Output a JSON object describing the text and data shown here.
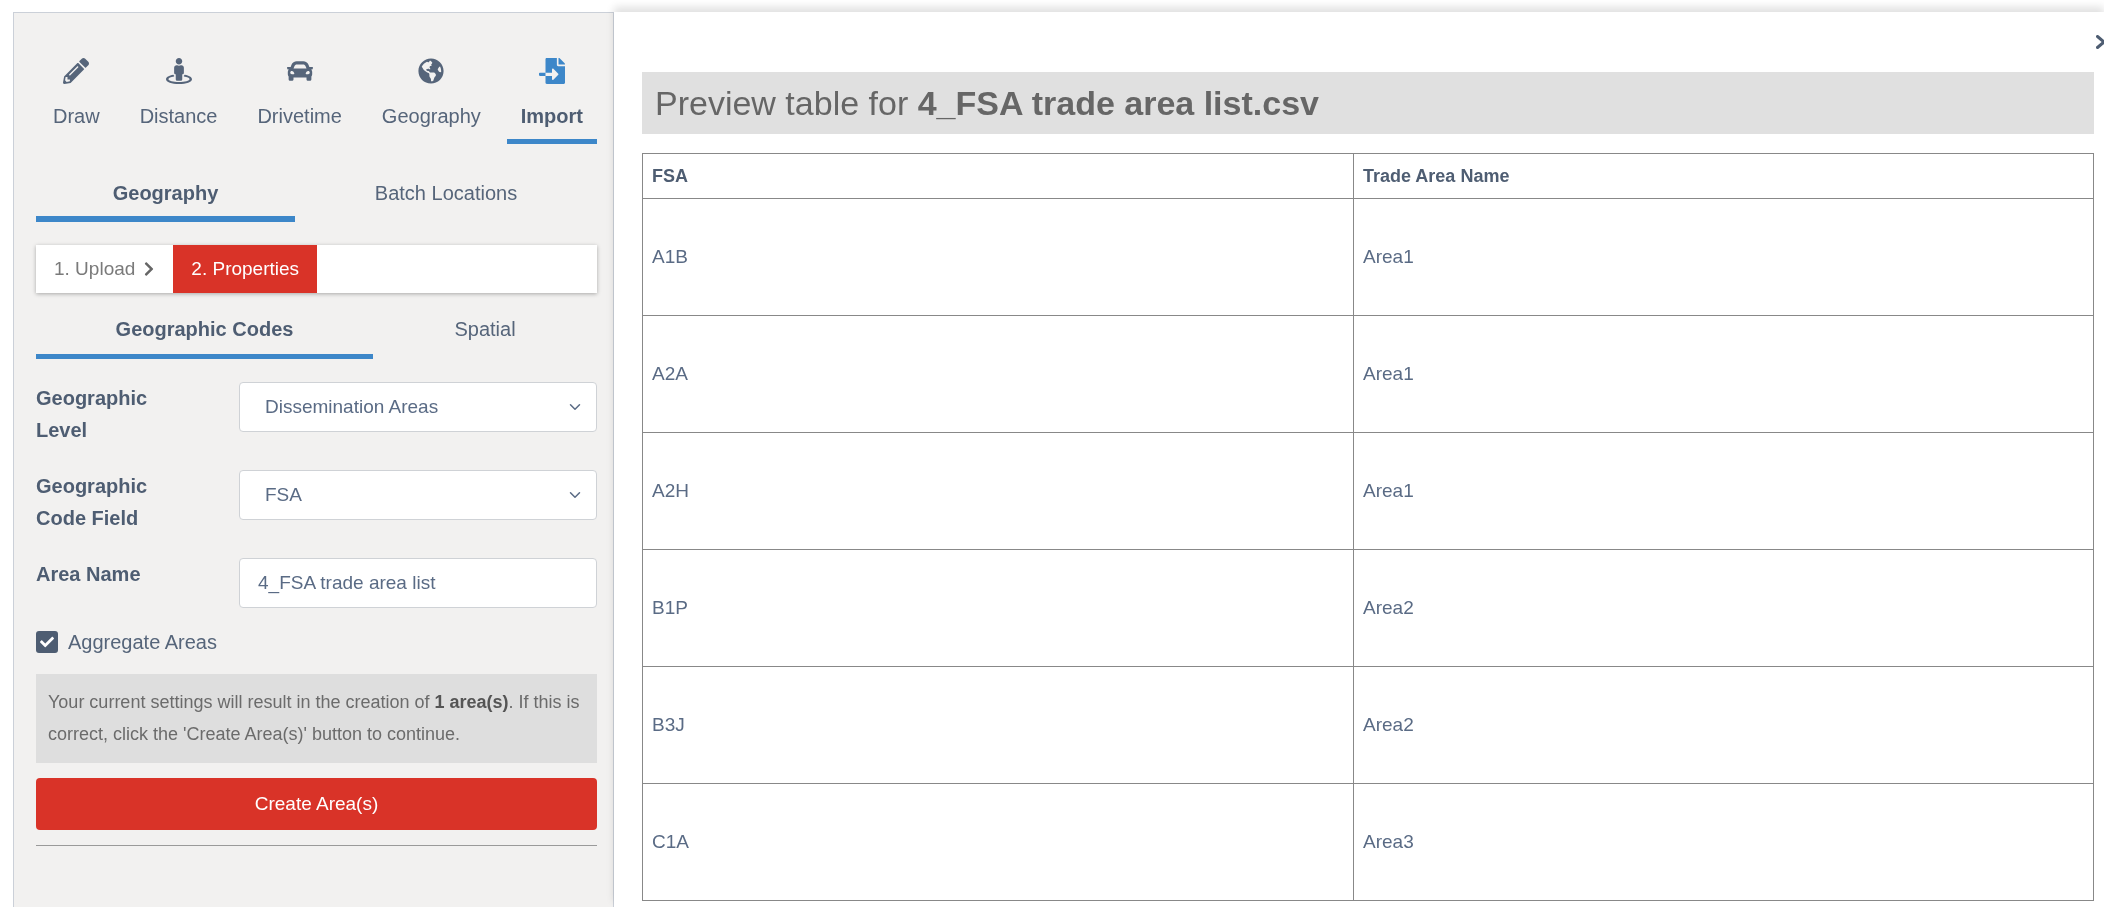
{
  "mode_tabs": [
    {
      "label": "Draw",
      "selected": false
    },
    {
      "label": "Distance",
      "selected": false
    },
    {
      "label": "Drivetime",
      "selected": false
    },
    {
      "label": "Geography",
      "selected": false
    },
    {
      "label": "Import",
      "selected": true
    }
  ],
  "sub_tabs": [
    {
      "label": "Geography",
      "selected": true
    },
    {
      "label": "Batch Locations",
      "selected": false
    }
  ],
  "steps": [
    {
      "label": "1. Upload",
      "selected": false
    },
    {
      "label": "2. Properties",
      "selected": true
    }
  ],
  "code_tabs": [
    {
      "label": "Geographic Codes",
      "selected": true
    },
    {
      "label": "Spatial",
      "selected": false
    }
  ],
  "form": [
    {
      "kind": "select",
      "label": "Geographic Level",
      "value": "Dissemination Areas"
    },
    {
      "kind": "select",
      "label": "Geographic Code Field",
      "value": "FSA"
    },
    {
      "kind": "text",
      "label": "Area Name",
      "value": "4_FSA trade area list"
    }
  ],
  "aggregate": {
    "label": "Aggregate Areas",
    "checked": true
  },
  "notice": "Your current settings will result in the creation of **1 area(s)**. If this is correct, click the 'Create Area(s)' button to continue.",
  "create_button": "Create Area(s)",
  "preview": {
    "title": "Preview table for **4_FSA trade area list.csv**",
    "columns": [
      "FSA",
      "Trade Area Name"
    ],
    "rows": [
      [
        "A1B",
        "Area1"
      ],
      [
        "A2A",
        "Area1"
      ],
      [
        "A2H",
        "Area1"
      ],
      [
        "B1P",
        "Area2"
      ],
      [
        "B3J",
        "Area2"
      ],
      [
        "C1A",
        "Area3"
      ]
    ]
  }
}
